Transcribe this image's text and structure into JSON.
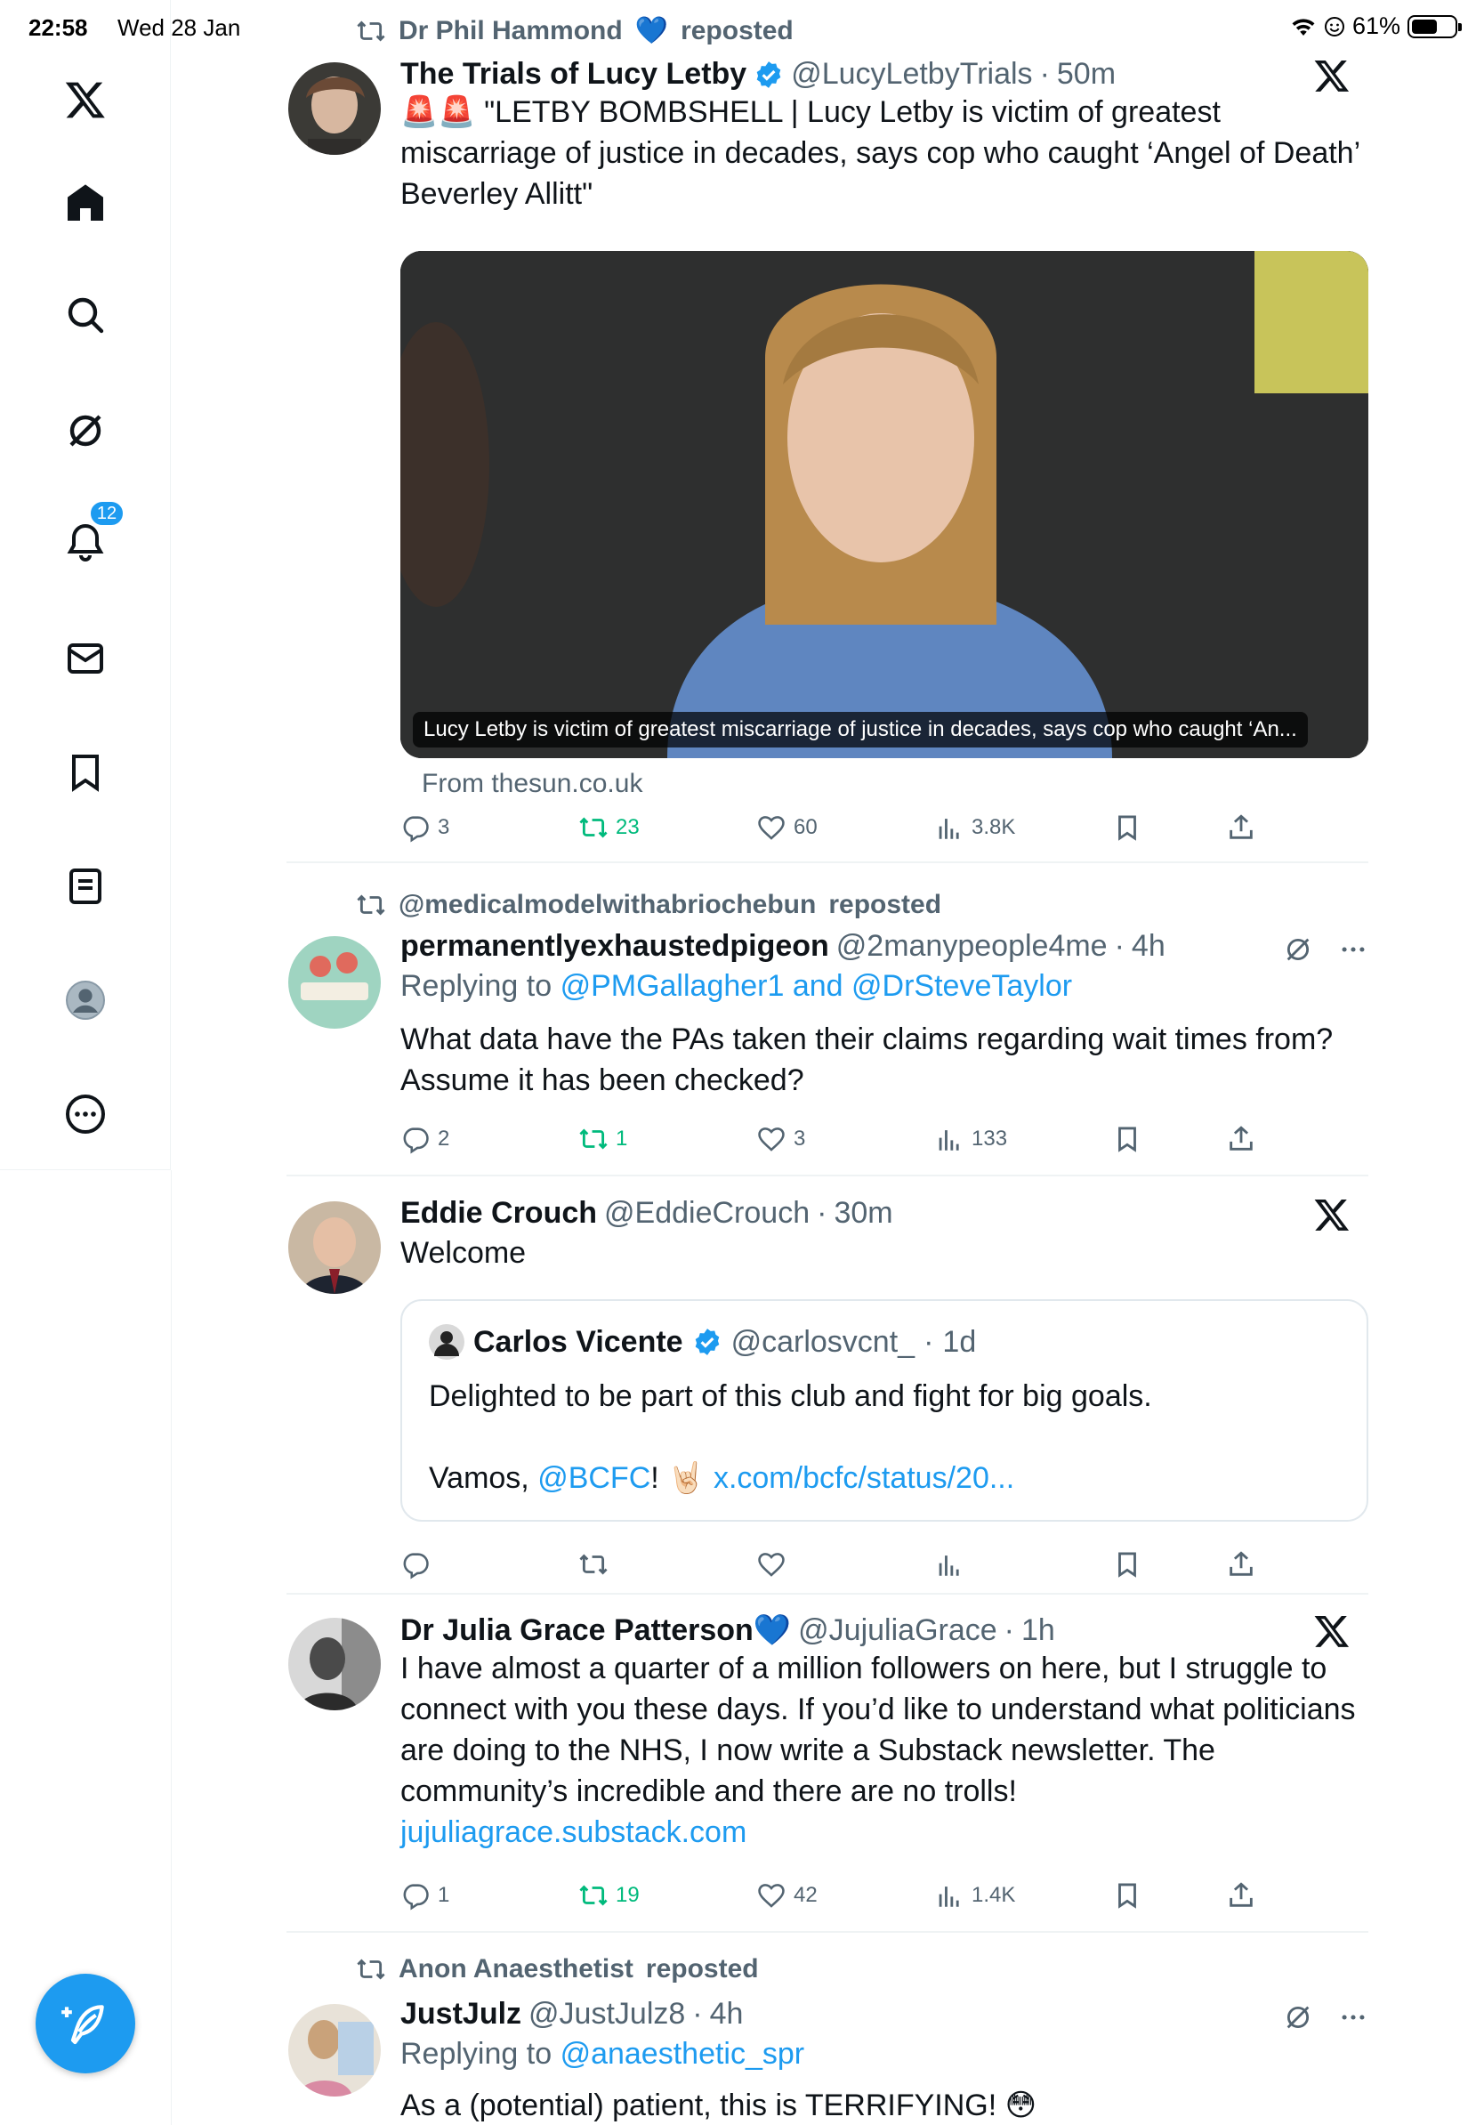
{
  "status_bar": {
    "time": "22:58",
    "date": "Wed 28 Jan",
    "battery": "61%",
    "battery_level": 0.61
  },
  "sidebar": {
    "notifications_badge": "12"
  },
  "posts": [
    {
      "repost_by": "Dr Phil Hammond",
      "repost_suffix": "reposted",
      "name": "The Trials of Lucy Letby",
      "handle": "@LucyLetbyTrials",
      "time": "50m",
      "text": "🚨🚨 \"LETBY BOMBSHELL | Lucy Letby is victim of greatest miscarriage of justice in decades, says cop who caught ‘Angel of Death’ Beverley Allitt\"",
      "media_caption": "Lucy Letby is victim of greatest miscarriage of justice in decades, says cop who caught ‘An...",
      "source": "From thesun.co.uk",
      "replies": "3",
      "reposts": "23",
      "likes": "60",
      "views": "3.8K"
    },
    {
      "repost_by": "@medicalmodelwithabriochebun",
      "repost_suffix": "reposted",
      "name": "permanentlyexhaustedpigeon",
      "handle": "@2manypeople4me",
      "time": "4h",
      "replying_prefix": "Replying to",
      "replying_to": "@PMGallagher1 and @DrSteveTaylor",
      "text": "What data have the PAs taken their claims regarding wait times from? Assume it has been checked?",
      "replies": "2",
      "reposts": "1",
      "likes": "3",
      "views": "133"
    },
    {
      "name": "Eddie Crouch",
      "handle": "@EddieCrouch",
      "time": "30m",
      "text": "Welcome",
      "quote": {
        "name": "Carlos Vicente",
        "handle": "@carlosvcnt_",
        "time": "1d",
        "line1": "Delighted to be part of this club and fight for big goals.",
        "line2_prefix": "Vamos, ",
        "mention": "@BCFC",
        "line2_suffix": "! 🤘🏻 ",
        "link": "x.com/bcfc/status/20..."
      }
    },
    {
      "name": "Dr Julia Grace Patterson💙",
      "handle": "@JujuliaGrace",
      "time": "1h",
      "text": "I have almost a quarter of a million followers on here, but I struggle to connect with you these days. If you’d like to understand what politicians are doing to the NHS, I now write a Substack newsletter. The community’s incredible and there are no trolls!",
      "link": "jujuliagrace.substack.com",
      "replies": "1",
      "reposts": "19",
      "likes": "42",
      "views": "1.4K"
    },
    {
      "repost_by": "Anon Anaesthetist",
      "repost_suffix": "reposted",
      "name": "JustJulz",
      "handle": "@JustJulz8",
      "time": "4h",
      "replying_prefix": "Replying to",
      "replying_to": "@anaesthetic_spr",
      "text": "As a (potential) patient, this is TERRIFYING! 😳"
    }
  ],
  "colors": {
    "accent": "#1d9bf0",
    "secondary_text": "#536471",
    "repost_green": "#00ba7c"
  },
  "icons": [
    "x-logo-icon",
    "home-icon",
    "search-icon",
    "grok-icon",
    "bell-icon",
    "mail-icon",
    "bookmark-icon",
    "list-icon",
    "profile-icon",
    "more-icon",
    "compose-icon",
    "repost-icon",
    "reply-icon",
    "like-icon",
    "views-icon",
    "share-icon",
    "verified-icon"
  ]
}
